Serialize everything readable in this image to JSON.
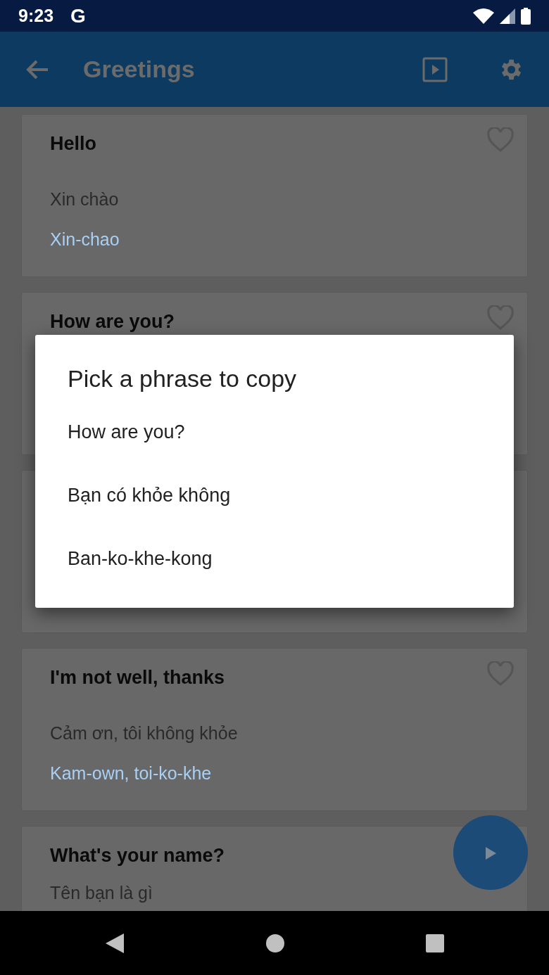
{
  "status_bar": {
    "time": "9:23",
    "app_letter": "G"
  },
  "app_bar": {
    "title": "Greetings"
  },
  "cards": [
    {
      "kind": "phrase",
      "title": "Hello",
      "translation": "Xin chào",
      "pronunciation": "Xin-chao"
    },
    {
      "kind": "phrase",
      "title": "How are you?"
    },
    {
      "kind": "phrase"
    },
    {
      "kind": "phrase",
      "title": "I'm not well, thanks",
      "translation": "Cảm ơn, tôi không khỏe",
      "pronunciation": "Kam-own, toi-ko-khe"
    },
    {
      "kind": "phrase",
      "title": "What's your name?",
      "translation": "Tên bạn là gì"
    }
  ],
  "dialog": {
    "title": "Pick a phrase to copy",
    "options": [
      "How are you?",
      "Bạn có khỏe không",
      "Ban-ko-khe-kong"
    ]
  }
}
